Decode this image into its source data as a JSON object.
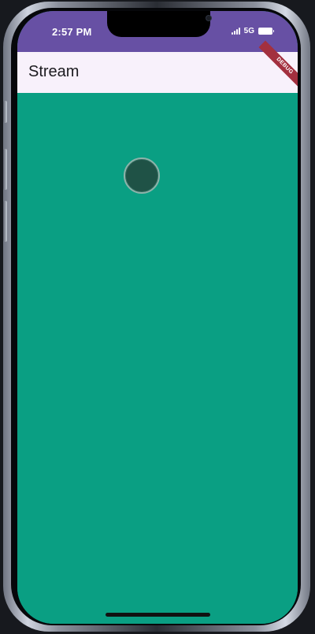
{
  "status_bar": {
    "time": "2:57 PM",
    "network": "5G",
    "background_color": "#6750a4",
    "icons": [
      "signal-icon",
      "battery-icon"
    ]
  },
  "app_bar": {
    "title": "Stream",
    "background_color": "#f8f1fb"
  },
  "debug_banner": {
    "label": "DEBUG",
    "color": "#a3303f"
  },
  "content": {
    "background_color": "#0a9f83",
    "dot_color": "#1f5246"
  }
}
